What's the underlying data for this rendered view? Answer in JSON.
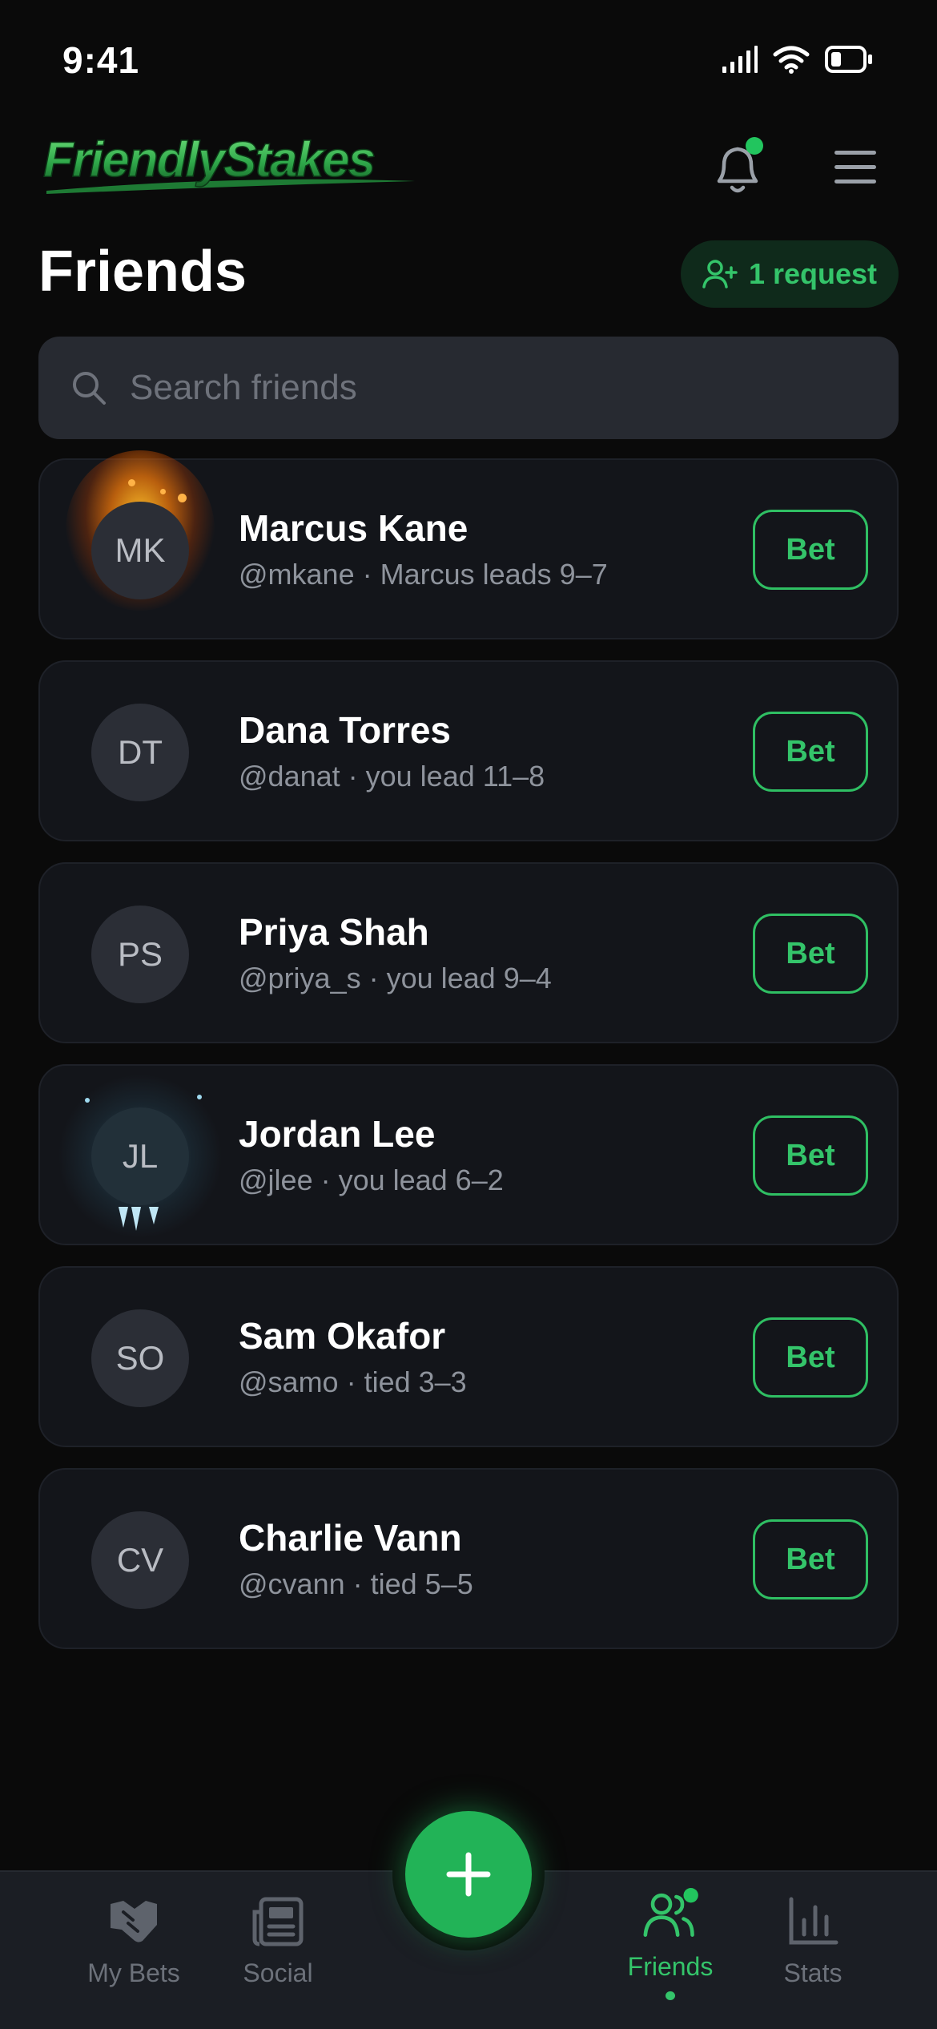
{
  "status_bar": {
    "time": "9:41"
  },
  "header": {
    "logo_text": "FriendlyStakes",
    "notification_badge_color": "#22c55e"
  },
  "page": {
    "title": "Friends",
    "request_label": "1 request"
  },
  "search": {
    "placeholder": "Search friends"
  },
  "friends": [
    {
      "initials": "MK",
      "name": "Marcus Kane",
      "subtitle": "@mkane · Marcus leads 9–7",
      "bet_label": "Bet",
      "effect": "fire"
    },
    {
      "initials": "DT",
      "name": "Dana Torres",
      "subtitle": "@danat · you lead 11–8",
      "bet_label": "Bet",
      "effect": "none"
    },
    {
      "initials": "PS",
      "name": "Priya Shah",
      "subtitle": "@priya_s · you lead 9–4",
      "bet_label": "Bet",
      "effect": "none"
    },
    {
      "initials": "JL",
      "name": "Jordan Lee",
      "subtitle": "@jlee · you lead 6–2",
      "bet_label": "Bet",
      "effect": "ice"
    },
    {
      "initials": "SO",
      "name": "Sam Okafor",
      "subtitle": "@samo · tied 3–3",
      "bet_label": "Bet",
      "effect": "none"
    },
    {
      "initials": "CV",
      "name": "Charlie Vann",
      "subtitle": "@cvann · tied 5–5",
      "bet_label": "Bet",
      "effect": "none"
    }
  ],
  "bottom_nav": {
    "items": [
      {
        "label": "My Bets",
        "icon": "handshake-icon",
        "active": false
      },
      {
        "label": "Social",
        "icon": "newspaper-icon",
        "active": false
      },
      {
        "label": "Friends",
        "icon": "friends-icon",
        "active": true
      },
      {
        "label": "Stats",
        "icon": "bar-chart-icon",
        "active": false
      }
    ],
    "fab_icon": "plus-icon"
  },
  "colors": {
    "accent": "#34c46a",
    "background": "#0a0a0a",
    "card": "#13151a"
  }
}
